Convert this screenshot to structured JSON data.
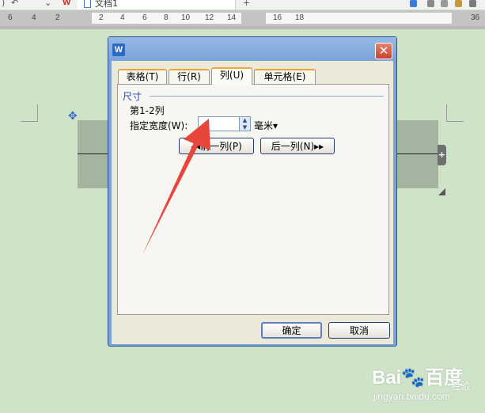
{
  "window": {
    "document_tab": "文档1",
    "app_logo": "W"
  },
  "ruler": {
    "ticks": [
      "6",
      "4",
      "2",
      "2",
      "4",
      "6",
      "8",
      "10",
      "12",
      "14",
      "16",
      "18",
      "36"
    ]
  },
  "dialog": {
    "app_icon": "W",
    "close_glyph": "✕",
    "tabs": [
      {
        "label": "表格(T)",
        "active": false
      },
      {
        "label": "行(R)",
        "active": false
      },
      {
        "label": "列(U)",
        "active": true
      },
      {
        "label": "单元格(E)",
        "active": false
      }
    ],
    "group_label": "尺寸",
    "column_range": "第1-2列",
    "width_label": "指定宽度(W):",
    "width_value": "",
    "unit": "毫米▾",
    "prev_column_button": "◂◂前一列(P)",
    "next_column_button": "后一列(N)▸▸",
    "ok_button": "确定",
    "cancel_button": "取消"
  },
  "watermark": {
    "logo": "Bai🐾百度",
    "text": "jingyan.baidu.com",
    "label": "经验"
  },
  "colors": {
    "page_background": "#cfe3c9",
    "annotation_arrow": "#e8453c",
    "dialog_frame": "#7aa3d8",
    "close_button": "#c8432a"
  }
}
